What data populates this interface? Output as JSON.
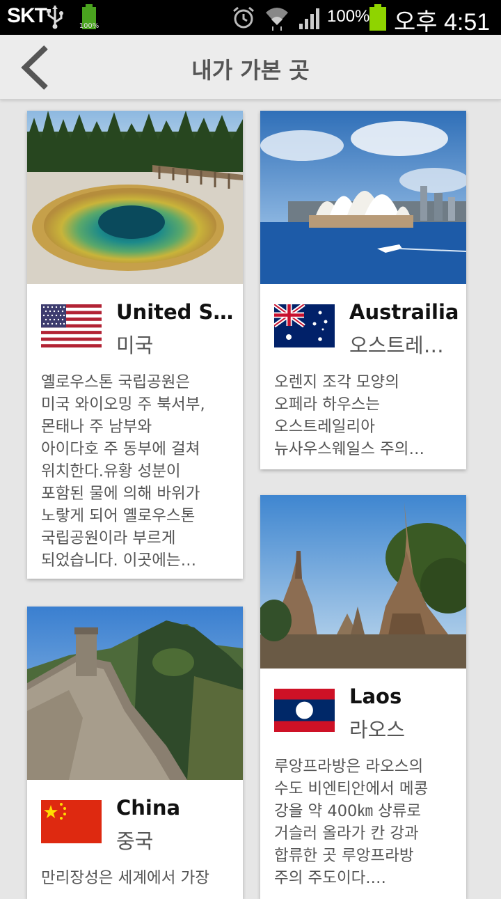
{
  "status_bar": {
    "carrier": "SKT",
    "battery_small": "100%",
    "battery_percent": "100%",
    "time": "오후 4:51"
  },
  "header": {
    "title": "내가 가본 곳",
    "back_icon": "chevron-left-icon"
  },
  "places": [
    {
      "name_en": "United Stat…",
      "name_ko": "미국",
      "flag": "usa-flag-icon",
      "desc": [
        "옐로우스톤 국립공원은",
        "미국 와이오밍 주 북서부,",
        "몬태나 주 남부와",
        "아이다호 주 동부에 걸쳐",
        "위치한다.유황 성분이",
        "포함된 물에 의해 바위가",
        "노랗게 되어 옐로우스톤",
        "국립공원이라 부르게",
        "되었습니다. 이곳에는…"
      ]
    },
    {
      "name_en": "Austrailia",
      "name_ko": "오스트레일…",
      "flag": "australia-flag-icon",
      "desc": [
        "오렌지 조각 모양의",
        "오페라 하우스는",
        "오스트레일리아",
        "뉴사우스웨일스 주의…"
      ]
    },
    {
      "name_en": "China",
      "name_ko": "중국",
      "flag": "china-flag-icon",
      "desc": [
        "만리장성은 세계에서 가장"
      ]
    },
    {
      "name_en": "Laos",
      "name_ko": "라오스",
      "flag": "laos-flag-icon",
      "desc": [
        "루앙프라방은 라오스의",
        "수도 비엔티안에서 메콩",
        "강을 약 400㎞ 상류로",
        "거슬러 올라가 칸 강과",
        "합류한 곳 루앙프라방",
        "주의 주도이다.…"
      ]
    }
  ],
  "colors": {
    "status_bar_bg": "#000000",
    "action_bar_bg": "#ececec",
    "background": "#e6e6e6",
    "title_text": "#555555",
    "battery_green": "#8fd400"
  }
}
